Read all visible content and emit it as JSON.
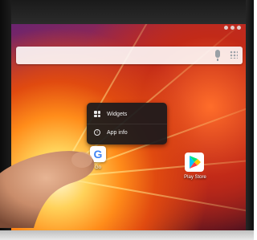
{
  "search_bar": {
    "icons": [
      "mic-icon",
      "app-grid-icon"
    ]
  },
  "context_menu": {
    "items": [
      {
        "label": "Widgets",
        "icon": "widgets-icon"
      },
      {
        "label": "App info",
        "icon": "info-icon"
      }
    ]
  },
  "home_apps": [
    {
      "label": "Go",
      "icon": "google-icon"
    },
    {
      "label": "Play Store",
      "icon": "play-store-icon"
    }
  ],
  "colors": {
    "menu_background": "#19191c",
    "menu_text": "#f2f2f2",
    "search_bar": "#ffffff"
  }
}
